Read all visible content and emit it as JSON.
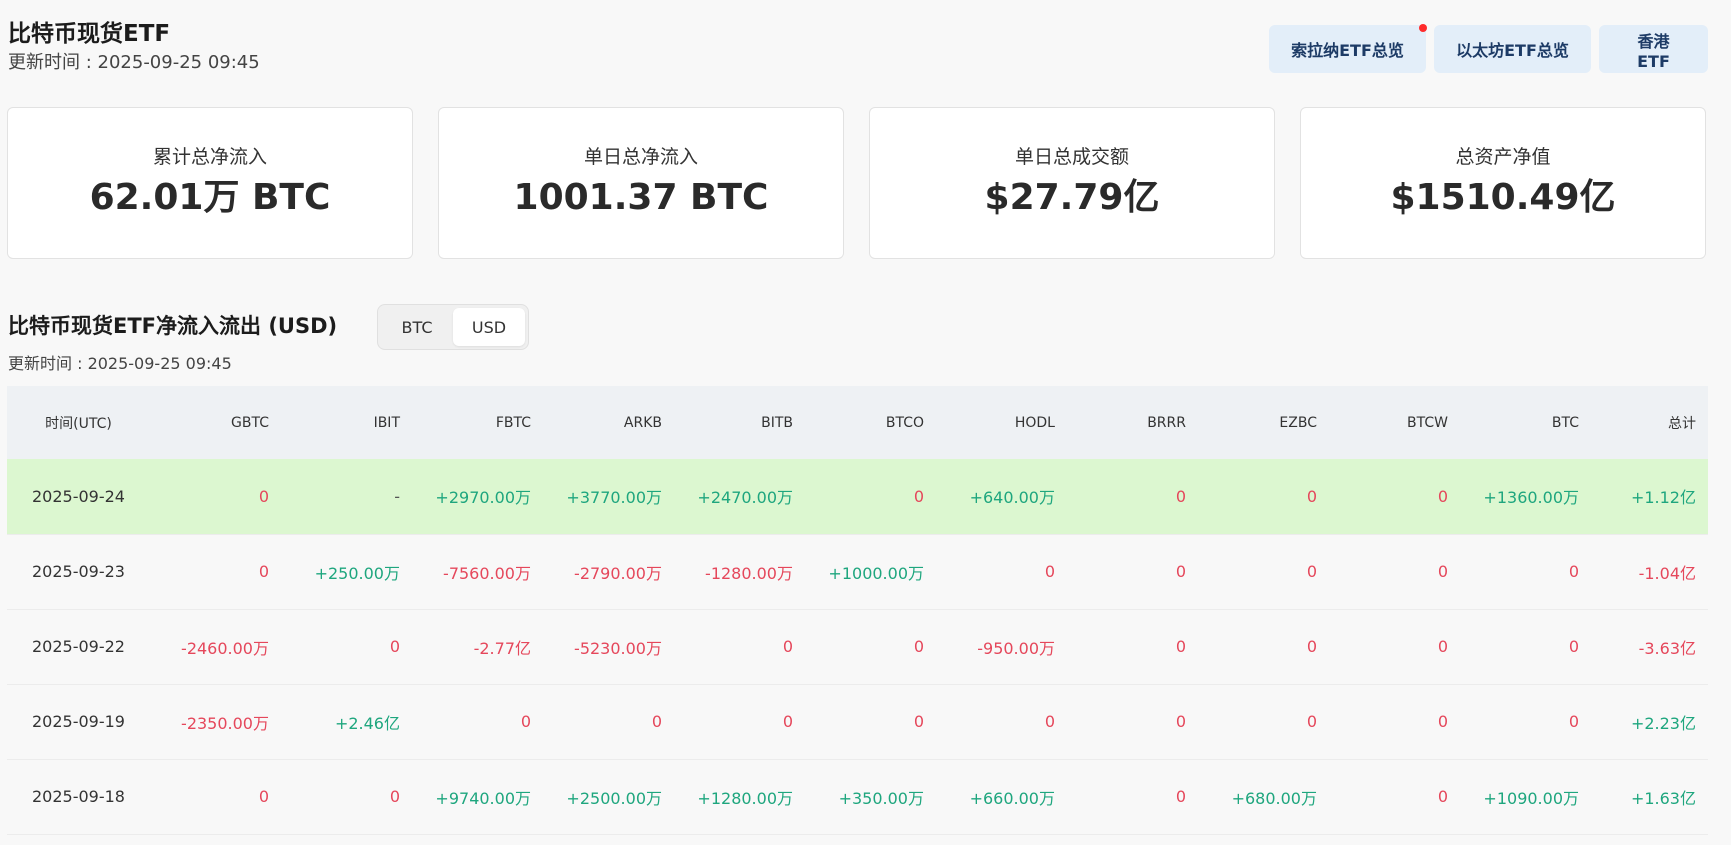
{
  "header": {
    "title": "比特币现货ETF",
    "update_time": "更新时间 : 2025-09-25 09:45"
  },
  "nav_buttons": [
    {
      "label": "索拉纳ETF总览",
      "has_dot": true
    },
    {
      "label": "以太坊ETF总览",
      "has_dot": false
    },
    {
      "label": "香港 ETF",
      "has_dot": false
    }
  ],
  "stats": [
    {
      "label": "累计总净流入",
      "value": "62.01万 BTC"
    },
    {
      "label": "单日总净流入",
      "value": "1001.37 BTC"
    },
    {
      "label": "单日总成交额",
      "value": "$27.79亿"
    },
    {
      "label": "总资产净值",
      "value": "$1510.49亿"
    }
  ],
  "flows": {
    "title": "比特币现货ETF净流入流出 (USD)",
    "toggle": {
      "options": [
        "BTC",
        "USD"
      ],
      "selected": "USD"
    },
    "update_time": "更新时间 : 2025-09-25 09:45",
    "columns": [
      "时间(UTC)",
      "GBTC",
      "IBIT",
      "FBTC",
      "ARKB",
      "BITB",
      "BTCO",
      "HODL",
      "BRRR",
      "EZBC",
      "BTCW",
      "BTC",
      "总计"
    ],
    "rows": [
      {
        "cells": [
          "2025-09-24",
          "0",
          "-",
          "+2970.00万",
          "+3770.00万",
          "+2470.00万",
          "0",
          "+640.00万",
          "0",
          "0",
          "0",
          "+1360.00万",
          "+1.12亿"
        ],
        "highlight": true
      },
      {
        "cells": [
          "2025-09-23",
          "0",
          "+250.00万",
          "-7560.00万",
          "-2790.00万",
          "-1280.00万",
          "+1000.00万",
          "0",
          "0",
          "0",
          "0",
          "0",
          "-1.04亿"
        ],
        "highlight": false
      },
      {
        "cells": [
          "2025-09-22",
          "-2460.00万",
          "0",
          "-2.77亿",
          "-5230.00万",
          "0",
          "0",
          "-950.00万",
          "0",
          "0",
          "0",
          "0",
          "-3.63亿"
        ],
        "highlight": false
      },
      {
        "cells": [
          "2025-09-19",
          "-2350.00万",
          "+2.46亿",
          "0",
          "0",
          "0",
          "0",
          "0",
          "0",
          "0",
          "0",
          "0",
          "+2.23亿"
        ],
        "highlight": false
      },
      {
        "cells": [
          "2025-09-18",
          "0",
          "0",
          "+9740.00万",
          "+2500.00万",
          "+1280.00万",
          "+350.00万",
          "+660.00万",
          "0",
          "+680.00万",
          "0",
          "+1090.00万",
          "+1.63亿"
        ],
        "highlight": false
      }
    ]
  },
  "colors": {
    "positive": "#1ea67e",
    "negative": "#e5475b",
    "highlight_row": "#dcf7d0",
    "nav_button_bg": "#e3eef9",
    "nav_button_text": "#1d3b66"
  }
}
